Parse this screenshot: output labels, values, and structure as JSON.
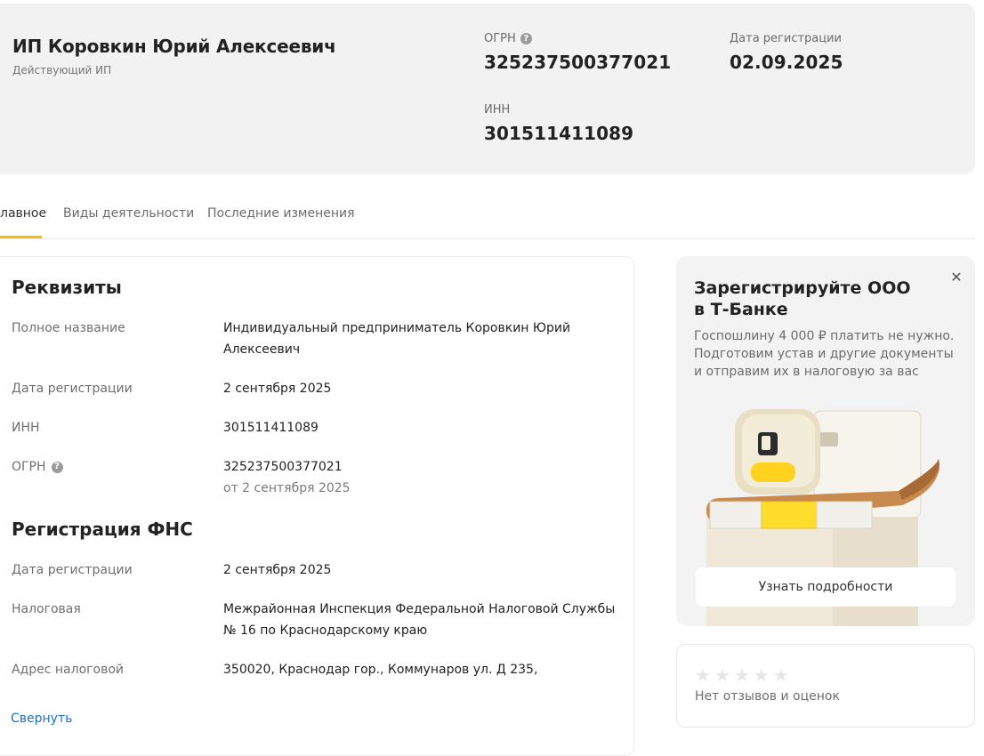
{
  "header": {
    "name": "ИП Коровкин Юрий Алексеевич",
    "status": "Действующий ИП",
    "ogrn_label": "ОГРН",
    "ogrn_value": "325237500377021",
    "reg_date_label": "Дата регистрации",
    "reg_date_value": "02.09.2025",
    "inn_label": "ИНН",
    "inn_value": "301511411089",
    "help_icon": "question-circle-icon"
  },
  "tabs": [
    {
      "label": "лавное",
      "active": true
    },
    {
      "label": "Виды деятельности",
      "active": false
    },
    {
      "label": "Последние изменения",
      "active": false
    }
  ],
  "requisites": {
    "title": "Реквизиты",
    "rows": [
      {
        "label": "Полное название",
        "value": "Индивидуальный предприниматель Коровкин Юрий Алексеевич"
      },
      {
        "label": "Дата регистрации",
        "value": "2 сентября 2025"
      },
      {
        "label": "ИНН",
        "value": "301511411089"
      },
      {
        "label": "ОГРН",
        "value": "325237500377021",
        "sub": "от 2 сентября 2025"
      }
    ]
  },
  "fns": {
    "title": "Регистрация ФНС",
    "rows": [
      {
        "label": "Дата регистрации",
        "value": "2 сентября 2025"
      },
      {
        "label": "Налоговая",
        "value": "Межрайонная Инспекция Федеральной Налоговой Службы № 16 по Краснодарскому краю"
      },
      {
        "label": "Адрес налоговой",
        "value": "350020, Краснодар гор., Коммунаров ул. Д 235,"
      }
    ]
  },
  "collapse_label": "Свернуть",
  "ad": {
    "title": "Зарегистрируйте ООО в Т-Банке",
    "text": "Госпошлину 4 000 ₽ платить не нужно. Подготовим устав и другие документы и отправим их в налоговую за вас",
    "button_label": "Узнать подробности",
    "close_icon": "close-icon",
    "accent_color": "#ffdd2d"
  },
  "reviews": {
    "rating": 0,
    "max": 5,
    "text": "Нет отзывов и оценок"
  }
}
